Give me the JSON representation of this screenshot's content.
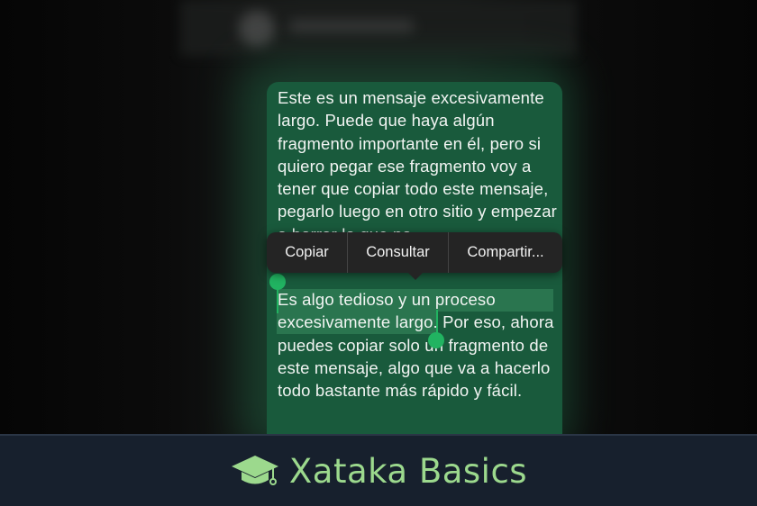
{
  "message": {
    "text_top": "Este es un mensaje excesivamente largo. Puede que haya algún fragmento importante en él, pero si quiero pegar ese fragmento voy a tener que copiar todo este mensaje, pegarlo luego en otro sitio y empezar a borrar lo que no",
    "text_bottom_selected": "Es algo tedioso y un proceso excesivamente largo",
    "text_bottom_rest": ". Por eso, ahora puedes copiar solo un fragmento de este mensaje, algo que va a hacerlo todo bastante más rápido y fácil."
  },
  "context_menu": {
    "items": [
      {
        "label": "Copiar",
        "icon": ""
      },
      {
        "label": "Consultar",
        "icon": ""
      },
      {
        "label": "Compartir...",
        "icon": ""
      }
    ]
  },
  "selection": {
    "handle_color": "#21b361",
    "highlight_color": "#2e7a52"
  },
  "footer": {
    "brand": "Xataka Basics",
    "icon": "graduation-cap-icon",
    "text_color": "#9cd98d",
    "background": "#17202d"
  },
  "colors": {
    "bubble": "#195a3c",
    "menu": "#242424"
  }
}
